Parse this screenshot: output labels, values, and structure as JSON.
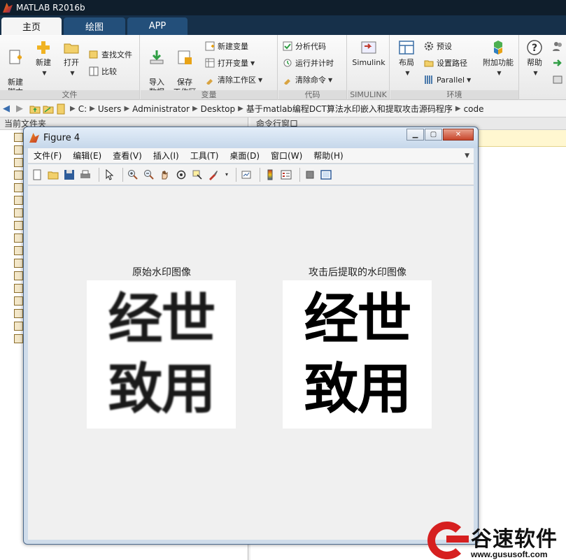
{
  "app": {
    "title": "MATLAB R2016b"
  },
  "tabs": [
    {
      "label": "主页"
    },
    {
      "label": "绘图"
    },
    {
      "label": "APP"
    }
  ],
  "ribbon": {
    "file": {
      "label": "文件",
      "new_script": "新建\n脚本",
      "new": "新建",
      "open": "打开",
      "find_files": "查找文件",
      "compare": "比较"
    },
    "variable": {
      "label": "变量",
      "import": "导入\n数据",
      "save_ws": "保存\n工作区",
      "new_var": "新建变量",
      "open_var": "打开变量",
      "clear_ws": "清除工作区"
    },
    "code": {
      "label": "代码",
      "analyze": "分析代码",
      "run_time": "运行并计时",
      "clear_cmd": "清除命令"
    },
    "simulink": {
      "label": "SIMULINK",
      "btn": "Simulink"
    },
    "env": {
      "label": "环境",
      "layout": "布局",
      "prefs": "预设",
      "set_path": "设置路径",
      "parallel": "Parallel",
      "addons": "附加功能"
    },
    "help": {
      "btn": "帮助"
    }
  },
  "address": {
    "crumbs": [
      "C:",
      "Users",
      "Administrator",
      "Desktop",
      "基于matlab编程DCT算法水印嵌入和提取攻击源码程序",
      "code"
    ]
  },
  "panels": {
    "current_folder": "当前文件夹",
    "command_window": "命令行窗口"
  },
  "figure": {
    "title": "Figure 4",
    "menu": [
      "文件(F)",
      "编辑(E)",
      "查看(V)",
      "插入(I)",
      "工具(T)",
      "桌面(D)",
      "窗口(W)",
      "帮助(H)"
    ],
    "axes": [
      {
        "title": "原始水印图像",
        "line1": "经世",
        "line2": "致用"
      },
      {
        "title": "攻击后提取的水印图像",
        "line1": "经世",
        "line2": "致用"
      }
    ]
  },
  "brand": {
    "name": "谷速软件",
    "url": "www.gususoft.com",
    "color": "#d62020"
  }
}
